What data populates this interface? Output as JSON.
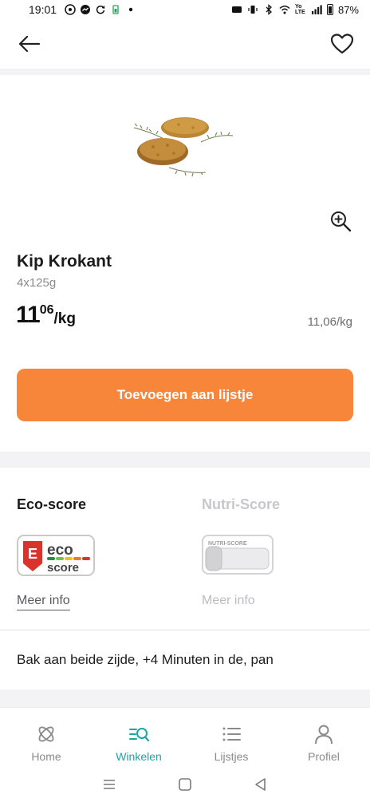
{
  "status_bar": {
    "time": "19:01",
    "battery": "87%",
    "network_label": "Yo LTE"
  },
  "product": {
    "name": "Kip Krokant",
    "size": "4x125g",
    "price_main": "11",
    "price_cents": "06",
    "price_unit": "/kg",
    "unit_price": "11,06/kg",
    "image_icon": "fried-chicken-schnitzel-image"
  },
  "actions": {
    "add_to_list": "Toevoegen aan lijstje"
  },
  "scores": {
    "eco_title": "Eco-score",
    "eco_grade": "E",
    "eco_word": "eco",
    "eco_sub": "score",
    "nutri_title": "Nutri-Score",
    "nutri_badge_text": "NUTRI-SCORE",
    "more_info": "Meer info",
    "more_info_disabled": "Meer info"
  },
  "instructions": "Bak aan beide zijde, +4 Minuten in de, pan",
  "bottom_nav": {
    "items": [
      {
        "label": "Home",
        "icon": "home-icon"
      },
      {
        "label": "Winkelen",
        "icon": "shop-search-icon"
      },
      {
        "label": "Lijstjes",
        "icon": "list-icon"
      },
      {
        "label": "Profiel",
        "icon": "profile-icon"
      }
    ],
    "active": "Winkelen"
  },
  "colors": {
    "accent_orange": "#f7863a",
    "active_teal": "#1aa7a0",
    "eco_red": "#d9332b"
  }
}
